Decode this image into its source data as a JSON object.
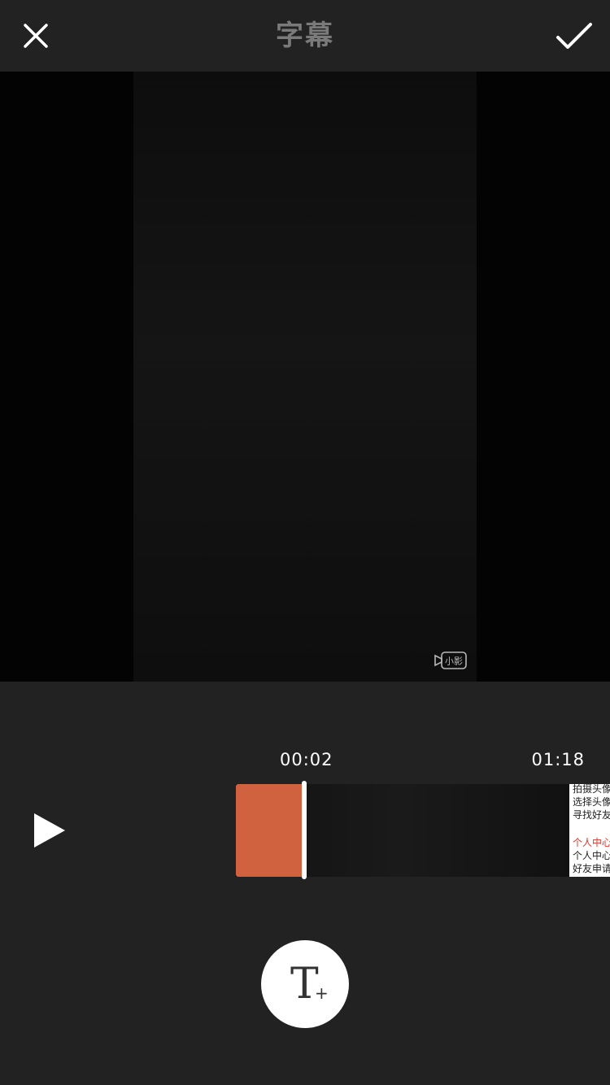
{
  "header": {
    "title": "字幕",
    "close_icon": "close-icon",
    "confirm_icon": "check-icon"
  },
  "preview": {
    "watermark_text": "小影"
  },
  "timeline": {
    "current_time": "00:02",
    "total_time": "01:18",
    "play_icon": "play-icon",
    "segment_color": "#d06240",
    "thumbnail_lines": [
      {
        "text": "拍摄头像",
        "color": "#222222"
      },
      {
        "text": "选择头像",
        "color": "#222222"
      },
      {
        "text": "寻找好友",
        "color": "#222222"
      },
      {
        "text": "",
        "color": "#222222"
      },
      {
        "text": "个人中心",
        "color": "#e0352b"
      },
      {
        "text": "个人中心",
        "color": "#222222"
      },
      {
        "text": "好友申请",
        "color": "#222222"
      }
    ]
  },
  "actions": {
    "add_text_icon": "add-text-icon",
    "add_text_glyph": "T",
    "add_text_plus": "+"
  },
  "colors": {
    "background": "#222222",
    "accent": "#d06240"
  }
}
